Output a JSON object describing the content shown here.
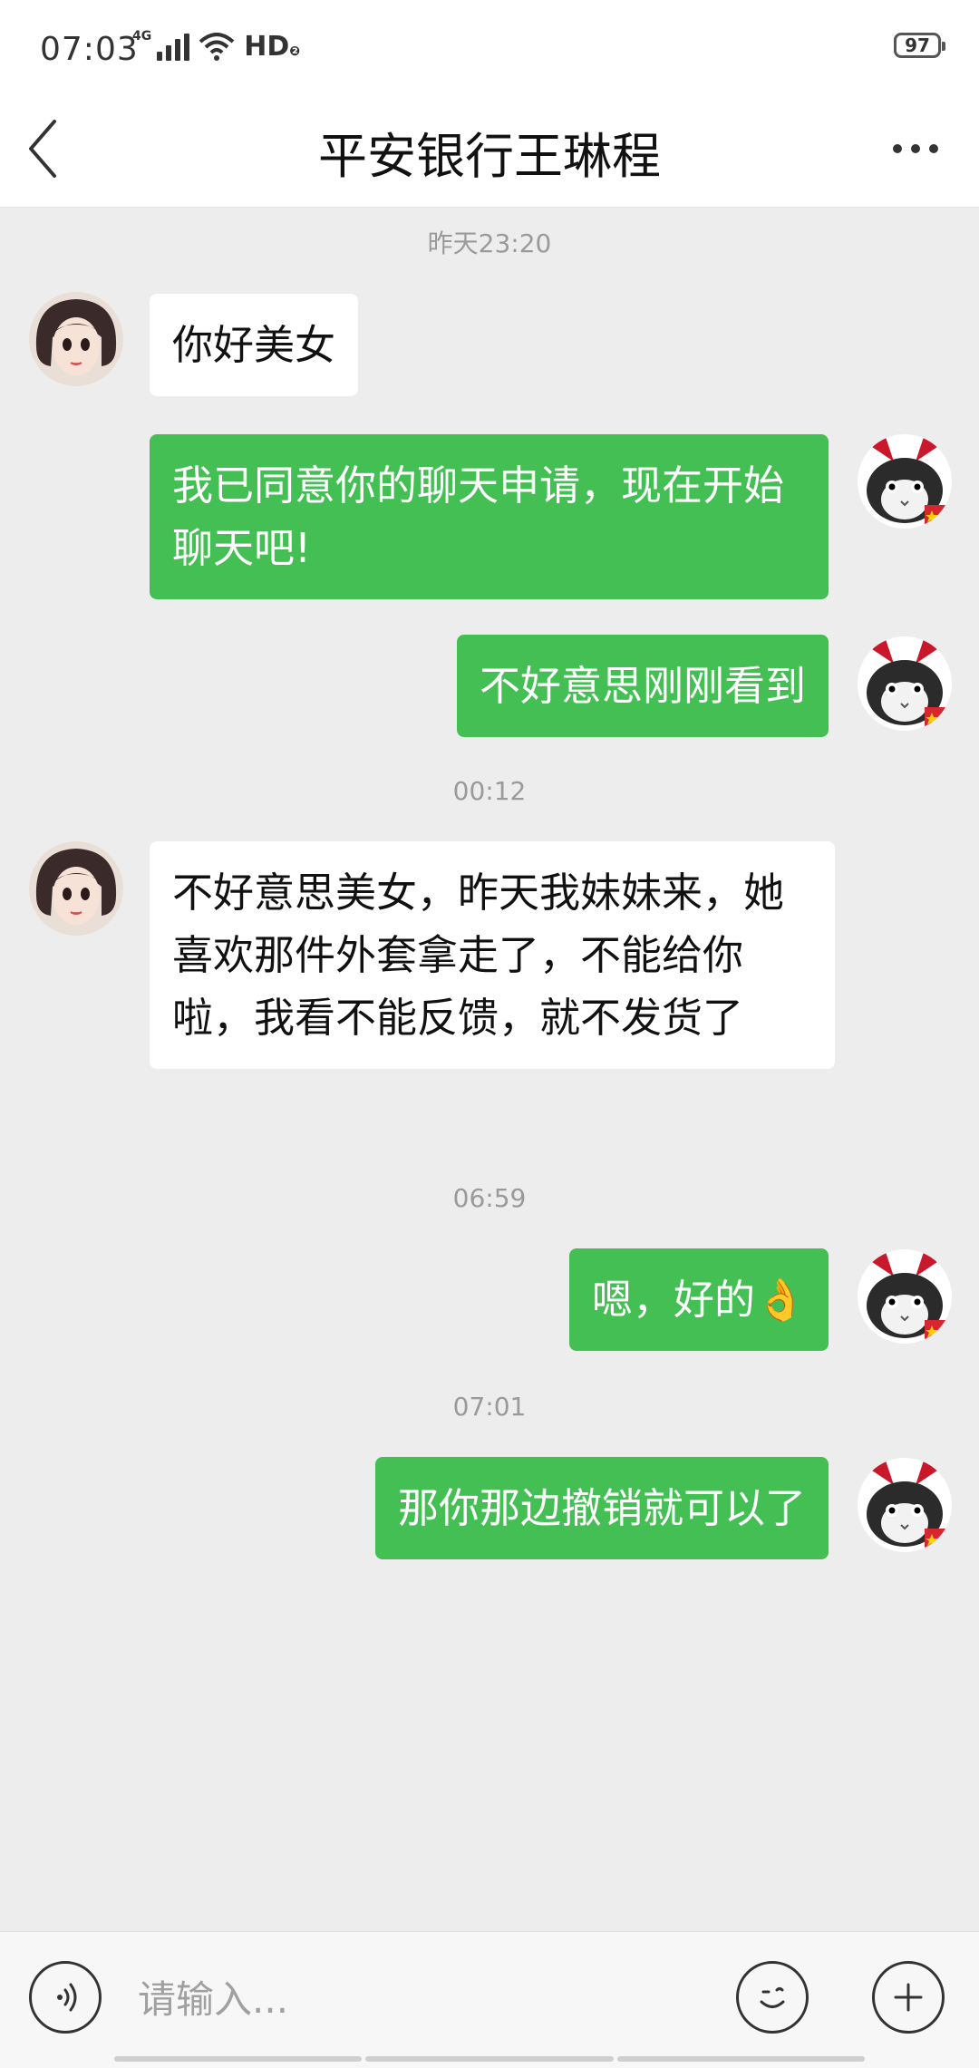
{
  "status_bar": {
    "time": "07:03",
    "network": "4G",
    "hd": "HD",
    "battery": "97"
  },
  "header": {
    "title": "平安银行王琳程"
  },
  "messages": [
    {
      "type": "timestamp",
      "text": "昨天23:20"
    },
    {
      "type": "message",
      "side": "left",
      "text": "你好美女"
    },
    {
      "type": "message",
      "side": "right",
      "text": "我已同意你的聊天申请，现在开始聊天吧!"
    },
    {
      "type": "message",
      "side": "right",
      "text": "不好意思刚刚看到"
    },
    {
      "type": "timestamp",
      "text": "00:12"
    },
    {
      "type": "message",
      "side": "left",
      "text": "不好意思美女，昨天我妹妹来，她喜欢那件外套拿走了，不能给你啦，我看不能反馈，就不发货了"
    },
    {
      "type": "timestamp",
      "text": "06:59"
    },
    {
      "type": "message",
      "side": "right",
      "text": "嗯，好的👌"
    },
    {
      "type": "timestamp",
      "text": "07:01"
    },
    {
      "type": "message",
      "side": "right",
      "text": "那你那边撤销就可以了"
    }
  ],
  "input": {
    "placeholder": "请输入..."
  },
  "icons": {
    "back": "back-arrow-icon",
    "more": "more-icon",
    "voice": "voice-icon",
    "emoji": "emoji-icon",
    "plus": "plus-icon"
  },
  "colors": {
    "accent_green": "#44bf53",
    "background": "#ededed",
    "bubble_white": "#ffffff"
  }
}
